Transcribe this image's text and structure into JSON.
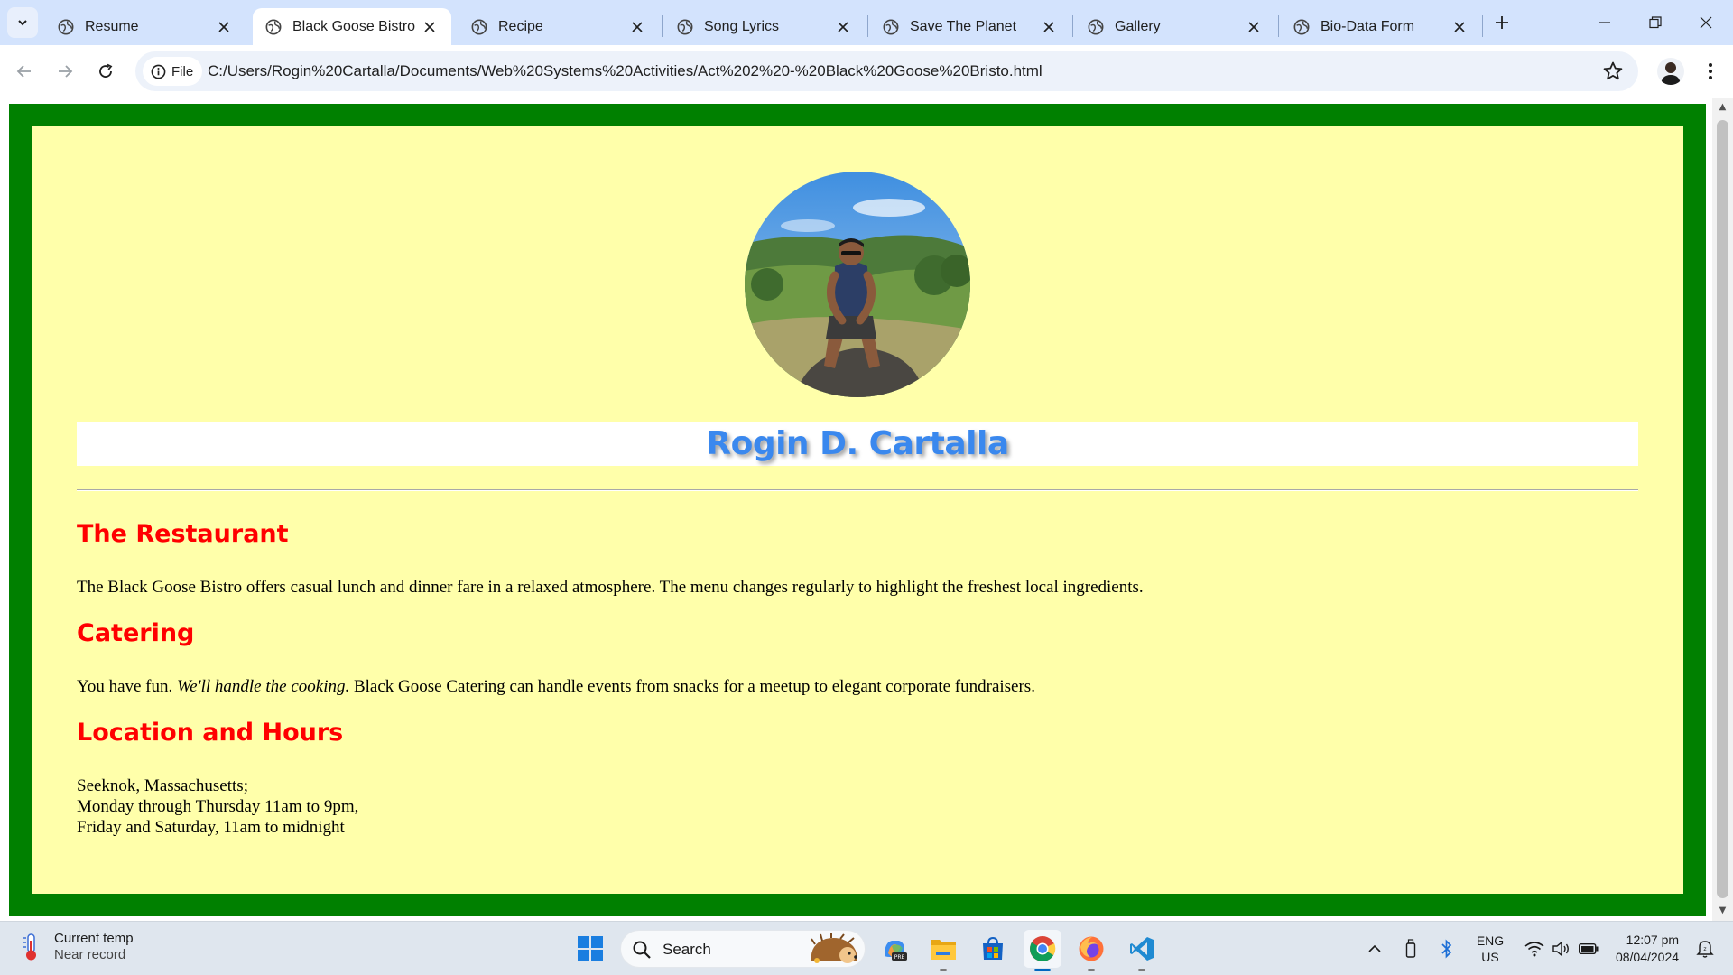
{
  "browser": {
    "tabs": [
      {
        "title": "Resume",
        "active": false
      },
      {
        "title": "Black Goose Bistro",
        "active": true
      },
      {
        "title": "Recipe",
        "active": false
      },
      {
        "title": "Song Lyrics",
        "active": false
      },
      {
        "title": "Save The Planet",
        "active": false
      },
      {
        "title": "Gallery",
        "active": false
      },
      {
        "title": "Bio-Data Form",
        "active": false
      }
    ],
    "site_info_label": "File",
    "url": "C:/Users/Rogin%20Cartalla/Documents/Web%20Systems%20Activities/Act%202%20-%20Black%20Goose%20Bristo.html"
  },
  "page": {
    "colors": {
      "border": "#008000",
      "background": "#ffffaa",
      "name": "#3a88ee",
      "heading": "#ff0000"
    },
    "name": "Rogin D. Cartalla",
    "sections": [
      {
        "heading": "The Restaurant",
        "text": "The Black Goose Bistro offers casual lunch and dinner fare in a relaxed atmosphere. The menu changes regularly to highlight the freshest local ingredients."
      },
      {
        "heading": "Catering",
        "text_before": "You have fun.",
        "text_em": "We'll handle the cooking.",
        "text_after": "Black Goose Catering can handle events from snacks for a meetup to elegant corporate fundraisers."
      },
      {
        "heading": "Location and Hours",
        "lines": [
          "Seeknok, Massachusetts;",
          "Monday through Thursday 11am to 9pm,",
          "Friday and Saturday, 11am to midnight"
        ]
      }
    ]
  },
  "taskbar": {
    "weather": {
      "line1": "Current temp",
      "line2": "Near record"
    },
    "search_placeholder": "Search",
    "language": {
      "line1": "ENG",
      "line2": "US"
    },
    "clock": {
      "time": "12:07 pm",
      "date": "08/04/2024"
    },
    "apps": [
      "start-icon",
      "copilot-icon",
      "file-explorer-icon",
      "microsoft-store-icon",
      "chrome-icon",
      "firefox-icon",
      "vscode-icon"
    ]
  }
}
